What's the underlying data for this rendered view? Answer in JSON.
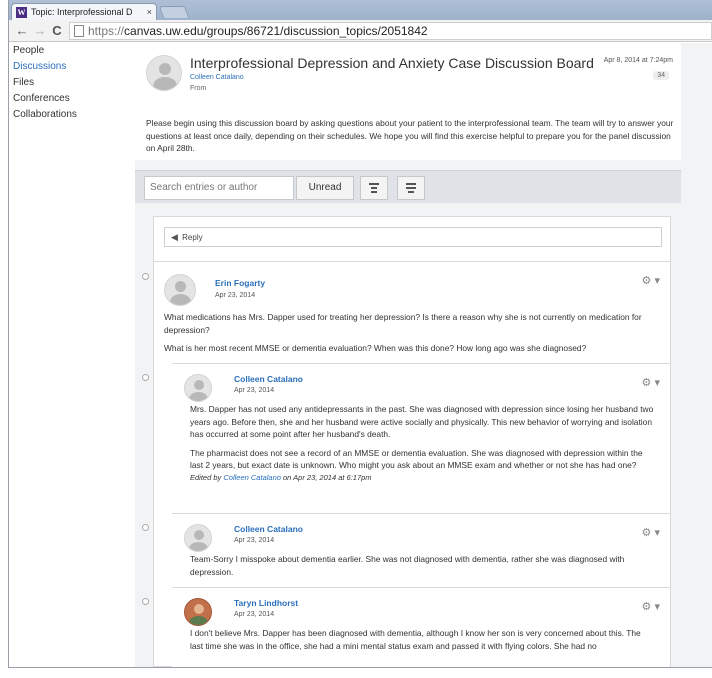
{
  "browser": {
    "tab_title": "Topic: Interprofessional D",
    "tab_close": "×",
    "favicon_letter": "W",
    "url_scheme": "https://",
    "url_rest": "canvas.uw.edu/groups/86721/discussion_topics/2051842",
    "back_icon": "←",
    "forward_icon": "→",
    "reload_icon": "C"
  },
  "sidebar": {
    "items": [
      {
        "label": "People"
      },
      {
        "label": "Discussions"
      },
      {
        "label": "Files"
      },
      {
        "label": "Conferences"
      },
      {
        "label": "Collaborations"
      }
    ]
  },
  "topic": {
    "title": "Interprofessional Depression and Anxiety Case Discussion Board",
    "author": "Colleen Catalano",
    "from_label": "From",
    "date": "Apr 8, 2014 at 7:24pm",
    "reply_count": "34",
    "body": "Please begin using this discussion board by asking questions about your patient to the interprofessional team. The team will try to answer your questions at least once daily, depending on their schedules. We hope you will find this exercise helpful to prepare you for the panel discussion on April 28th."
  },
  "toolbar": {
    "search_placeholder": "Search entries or author",
    "unread_label": "Unread"
  },
  "reply_box": {
    "label": "Reply"
  },
  "entries": [
    {
      "author": "Erin Fogarty",
      "date": "Apr 23, 2014",
      "paragraphs": [
        "What medications has Mrs. Dapper used for treating her depression? Is there a reason why she is not currently on medication for depression?",
        "What is her most recent MMSE or dementia evaluation?  When was this done? How long ago was she diagnosed?"
      ]
    },
    {
      "author": "Colleen Catalano",
      "date": "Apr 23, 2014",
      "paragraphs": [
        "Mrs. Dapper has not used any antidepressants in the past. She was diagnosed with depression since losing her husband two years ago. Before then, she and her husband were active socially and physically. This new behavior of worrying and isolation has occurred at some point after her husband's death.",
        "The pharmacist does not see a record of an MMSE or dementia evaluation. She was diagnosed with depression within the last 2 years, but exact date is unknown. Who might you ask about an MMSE exam and whether or not she has had one?"
      ],
      "edited_prefix": "Edited by",
      "edited_name": "Colleen Catalano",
      "edited_suffix": "on Apr 23, 2014 at 6:17pm"
    },
    {
      "author": "Colleen Catalano",
      "date": "Apr 23, 2014",
      "paragraphs": [
        "Team-Sorry I misspoke about dementia earlier. She was not diagnosed with dementia, rather she was diagnosed with depression."
      ]
    },
    {
      "author": "Taryn Lindhorst",
      "date": "Apr 23, 2014",
      "paragraphs": [
        "I don't believe Mrs. Dapper has been diagnosed with dementia, although I know her son is very concerned about this.  The last time she was in the office, she had a mini mental status exam and passed it with flying colors.  She had no"
      ]
    }
  ],
  "gear_icon": "⚙ ▾"
}
